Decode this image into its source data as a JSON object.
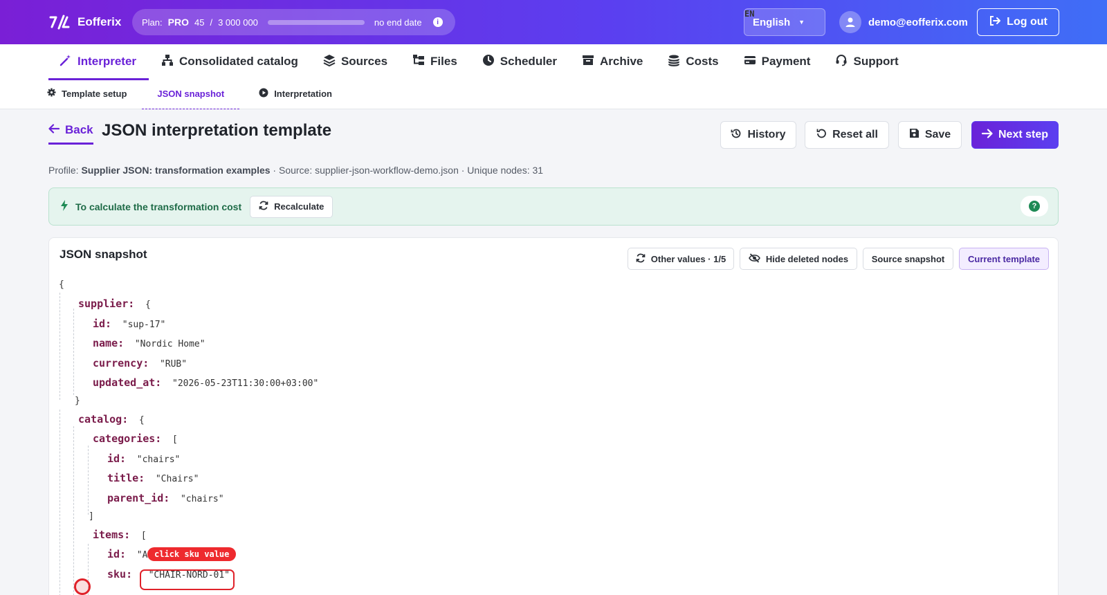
{
  "app": {
    "name": "Eofferix"
  },
  "plan": {
    "label": "Plan:",
    "tier": "PRO",
    "used": "45",
    "separator": "/",
    "limit": "3 000 000",
    "usage_fraction": 1.5e-05,
    "end_label": "no end date"
  },
  "lang": {
    "code": "EN",
    "name": "English"
  },
  "user": {
    "email": "demo@eofferix.com"
  },
  "logout_label": "Log out",
  "nav": {
    "items": [
      {
        "label": "Interpreter",
        "icon": "magic-wand-icon",
        "active": true
      },
      {
        "label": "Consolidated catalog",
        "icon": "sitemap-icon"
      },
      {
        "label": "Sources",
        "icon": "layers-icon"
      },
      {
        "label": "Files",
        "icon": "folder-tree-icon"
      },
      {
        "label": "Scheduler",
        "icon": "clock-icon"
      },
      {
        "label": "Archive",
        "icon": "archive-icon"
      },
      {
        "label": "Costs",
        "icon": "coins-icon"
      },
      {
        "label": "Payment",
        "icon": "credit-card-icon"
      },
      {
        "label": "Support",
        "icon": "headset-icon"
      }
    ],
    "subitems": [
      {
        "label": "Template setup",
        "icon": "gear-icon"
      },
      {
        "label": "JSON snapshot",
        "active": true
      },
      {
        "label": "Interpretation",
        "icon": "play-circle-icon"
      }
    ]
  },
  "page": {
    "back_label": "Back",
    "title": "JSON interpretation template",
    "buttons": {
      "history": "History",
      "reset": "Reset all",
      "save": "Save",
      "next": "Next step"
    },
    "profile_prefix": "Profile:",
    "profile_name": "Supplier JSON: transformation examples",
    "profile_rest": " · Source: supplier-json-workflow-demo.json · Unique nodes: 31"
  },
  "alert": {
    "text": "To calculate the transformation cost",
    "button": "Recalculate",
    "help": "?"
  },
  "snapshot": {
    "title": "JSON snapshot",
    "toolbar": {
      "other_values": "Other values · 1/5",
      "hide_deleted": "Hide deleted nodes",
      "source_snapshot": "Source snapshot",
      "current_template": "Current template"
    },
    "lines": [
      {
        "text": "{"
      },
      {
        "key": "supplier:",
        "value": "{"
      },
      {
        "key": "id:",
        "value": "\"sup-17\""
      },
      {
        "key": "name:",
        "value": "\"Nordic Home\""
      },
      {
        "key": "currency:",
        "value": "\"RUB\""
      },
      {
        "key": "updated_at:",
        "value": "\"2026-05-23T11:30:00+03:00\""
      },
      {
        "text": "}"
      },
      {
        "key": "catalog:",
        "value": "{"
      },
      {
        "key": "categories:",
        "value": "["
      },
      {
        "key": "id:",
        "value": "\"chairs\""
      },
      {
        "key": "title:",
        "value": "\"Chairs\""
      },
      {
        "key": "parent_id:",
        "value": "\"chairs\""
      },
      {
        "text": "]"
      },
      {
        "key": "items:",
        "value": "["
      },
      {
        "key": "id:",
        "value": "\"A"
      },
      {
        "key": "sku:",
        "value": "\"CHAIR-NORD-01\""
      }
    ],
    "hint": "click sku value"
  }
}
